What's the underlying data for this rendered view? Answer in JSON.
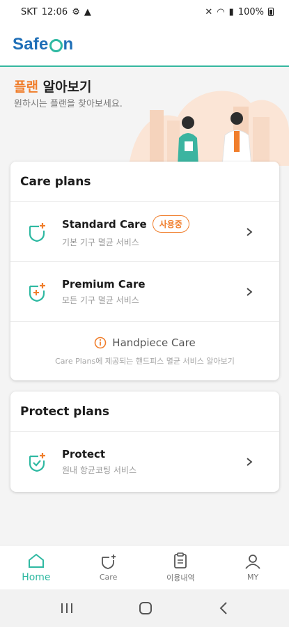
{
  "status_bar": {
    "carrier": "SKT",
    "time": "12:06",
    "battery": "100%"
  },
  "brand": {
    "logo_prefix": "Safe",
    "logo_suffix": "n"
  },
  "hero": {
    "title_accent": "플랜",
    "title_rest": " 알아보기",
    "subtitle": "원하시는 플랜을 찾아보세요."
  },
  "care_plans": {
    "header": "Care plans",
    "items": [
      {
        "title": "Standard Care",
        "badge": "사용중",
        "subtitle": "기본 기구 멸균 서비스"
      },
      {
        "title": "Premium Care",
        "subtitle": "모든 기구 멸균 서비스"
      }
    ],
    "info_title": "Handpiece Care",
    "info_subtitle": "Care Plans에 제공되는 핸드피스 멸균 서비스 알아보기"
  },
  "protect_plans": {
    "header": "Protect plans",
    "items": [
      {
        "title": "Protect",
        "subtitle": "원내 항균코팅 서비스"
      }
    ]
  },
  "tabbar": {
    "tabs": [
      {
        "label": "Home",
        "icon": "home-icon",
        "active": true
      },
      {
        "label": "Care",
        "icon": "shield-plus-icon"
      },
      {
        "label": "이용내역",
        "icon": "clipboard-icon"
      },
      {
        "label": "MY",
        "icon": "person-icon"
      }
    ]
  },
  "colors": {
    "accent": "#f07e2c",
    "brand_teal": "#2fb9a2",
    "brand_blue": "#1f6fb7"
  }
}
